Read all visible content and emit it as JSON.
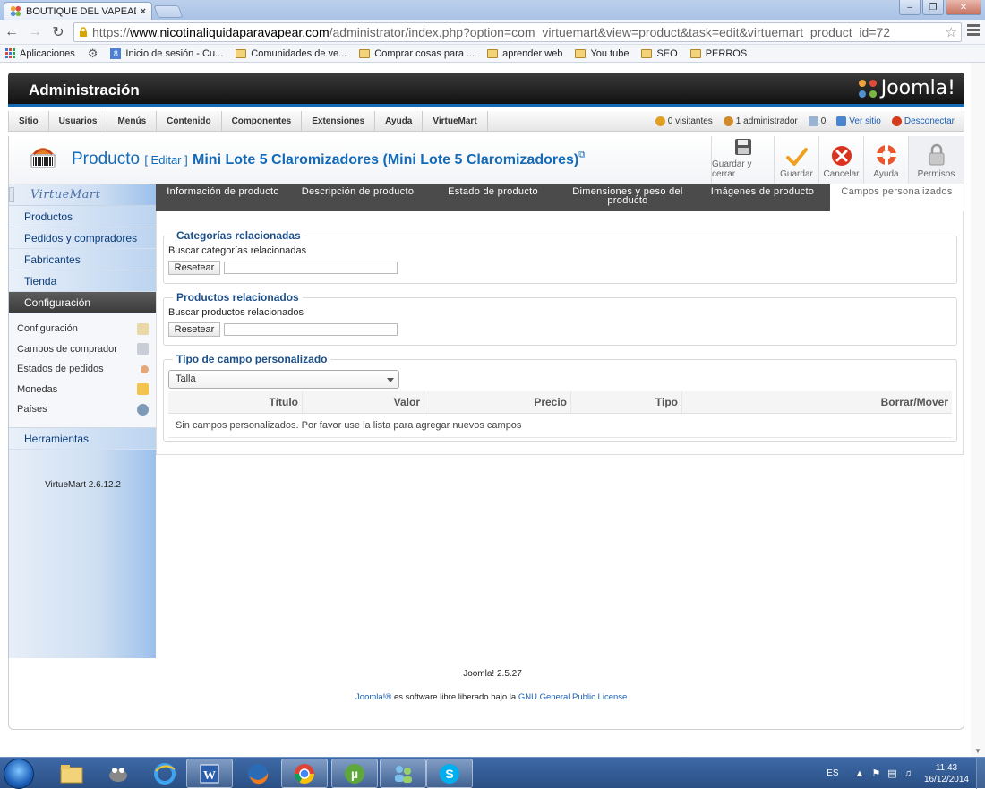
{
  "browser": {
    "tab_title": "BOUTIQUE DEL VAPEADO",
    "tab_close": "×",
    "url_prefix": "https://",
    "url_host": "www.nicotinaliquidaparavapear.com",
    "url_path": "/administrator/index.php?option=com_virtuemart&view=product&task=edit&virtuemart_product_id=72",
    "bookmarks": [
      "Aplicaciones",
      "Inicio de sesión - Cu...",
      "Comunidades de ve...",
      "Comprar cosas para ...",
      "aprender web",
      "You tube",
      "SEO",
      "PERROS"
    ]
  },
  "header": {
    "title": "Administración",
    "brand": "Joomla!"
  },
  "menu": {
    "items": [
      "Sitio",
      "Usuarios",
      "Menús",
      "Contenido",
      "Componentes",
      "Extensiones",
      "Ayuda",
      "VirtueMart"
    ],
    "visitors": "0 visitantes",
    "admins": "1 administrador",
    "messages": "0",
    "view_site": "Ver sitio",
    "logout": "Desconectar"
  },
  "page": {
    "title": "Producto",
    "action": "[ Editar ]",
    "product_name": "Mini Lote 5 Claromizadores (Mini Lote 5 Claromizadores)"
  },
  "toolbar": {
    "save_close": "Guardar y cerrar",
    "save": "Guardar",
    "cancel": "Cancelar",
    "help": "Ayuda",
    "permissions": "Permisos"
  },
  "sidebar": {
    "logo": "VirtueMart",
    "items": [
      "Productos",
      "Pedidos y compradores",
      "Fabricantes",
      "Tienda",
      "Configuración"
    ],
    "sub_items": [
      "Configuración",
      "Campos de comprador",
      "Estados de pedidos",
      "Monedas",
      "Países"
    ],
    "tools": "Herramientas",
    "version": "VirtueMart 2.6.12.2"
  },
  "tabs": [
    "Información de producto",
    "Descripción de producto",
    "Estado de producto",
    "Dimensiones y peso del producto",
    "Imágenes de producto",
    "Campos personalizados"
  ],
  "active_tab": "Campos personalizados",
  "related_categories": {
    "legend": "Categorías relacionadas",
    "label": "Buscar categorías relacionadas",
    "button": "Resetear",
    "value": ""
  },
  "related_products": {
    "legend": "Productos relacionados",
    "label": "Buscar productos relacionados",
    "button": "Resetear",
    "value": ""
  },
  "custom_field": {
    "legend": "Tipo de campo personalizado",
    "selected": "Talla",
    "columns": [
      "Título",
      "Valor",
      "Precio",
      "Tipo",
      "Borrar/Mover"
    ],
    "empty_message": "Sin campos personalizados. Por favor use la lista para agregar nuevos campos"
  },
  "footer": {
    "version": "Joomla! 2.5.27",
    "license_pre": "Joomla!® es software libre liberado bajo la ",
    "license_link": "GNU General Public License",
    "license_post": "."
  },
  "taskbar": {
    "lang": "ES",
    "time": "11:43",
    "date": "16/12/2014"
  }
}
